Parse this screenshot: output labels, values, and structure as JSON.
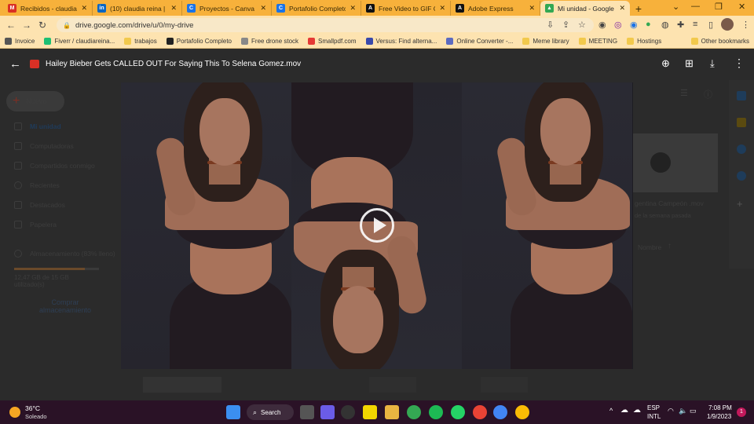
{
  "tabs": [
    {
      "label": "Recibidos - claudia.re",
      "icon": "gmail-icon",
      "color": "#d93025",
      "glyph": "M",
      "active": false
    },
    {
      "label": "(10) claudia reina | Lin",
      "icon": "linkedin-icon",
      "color": "#0a66c2",
      "glyph": "in",
      "active": false
    },
    {
      "label": "Proyectos - Canva",
      "icon": "canva-icon",
      "color": "#1a73e8",
      "glyph": "C",
      "active": false
    },
    {
      "label": "Portafolio Completo",
      "icon": "canva-icon",
      "color": "#1a73e8",
      "glyph": "C",
      "active": false
    },
    {
      "label": "Free Video to GIF Co",
      "icon": "adobe-icon",
      "color": "#111",
      "glyph": "A",
      "active": false
    },
    {
      "label": "Adobe Express",
      "icon": "adobe-icon",
      "color": "#111",
      "glyph": "A",
      "active": false
    },
    {
      "label": "Mi unidad - Google D",
      "icon": "drive-icon",
      "color": "#34a853",
      "glyph": "▲",
      "active": true
    }
  ],
  "url": "drive.google.com/drive/u/0/my-drive",
  "bookmarks": [
    {
      "label": "Invoice",
      "color": "#555"
    },
    {
      "label": "Fiverr / claudiareina...",
      "color": "#1dbf73"
    },
    {
      "label": "trabajos",
      "color": "#f2c94c"
    },
    {
      "label": "Portafolio Completo",
      "color": "#222"
    },
    {
      "label": "Free drone stock",
      "color": "#888"
    },
    {
      "label": "Smallpdf.com",
      "color": "#e53935"
    },
    {
      "label": "Versus: Find alterna...",
      "color": "#3949ab"
    },
    {
      "label": "Online Converter -...",
      "color": "#5c6bc0"
    },
    {
      "label": "Meme library",
      "color": "#f2c94c"
    },
    {
      "label": "MEETING",
      "color": "#f2c94c"
    },
    {
      "label": "Hostings",
      "color": "#f2c94c"
    },
    {
      "label": "Other bookmarks",
      "color": "#f2c94c"
    }
  ],
  "preview": {
    "file_title": "Hailey Bieber Gets CALLED OUT For Saying This To Selena Gomez.mov"
  },
  "drive": {
    "new_label": "Nuevo",
    "sidebar": [
      "Mi unidad",
      "Computadoras",
      "Compartidos conmigo",
      "Recientes",
      "Destacados",
      "Papelera"
    ],
    "storage_label": "Almacenamiento (83% lleno)",
    "storage_used": "12,47 GB de 15 GB utilizado(s)",
    "storage_fraction": 0.83,
    "buy_storage": "Comprar almacenamiento",
    "file_name": "gentina Campeón .mov",
    "file_meta": "de la semana pasada",
    "sort_label": "Nombre"
  },
  "taskbar": {
    "weather_temp": "36°C",
    "weather_desc": "Soleado",
    "search_label": "Search",
    "lang_line1": "ESP",
    "lang_line2": "INTL",
    "time": "7:08 PM",
    "date": "1/9/2023",
    "notification_count": "1"
  }
}
